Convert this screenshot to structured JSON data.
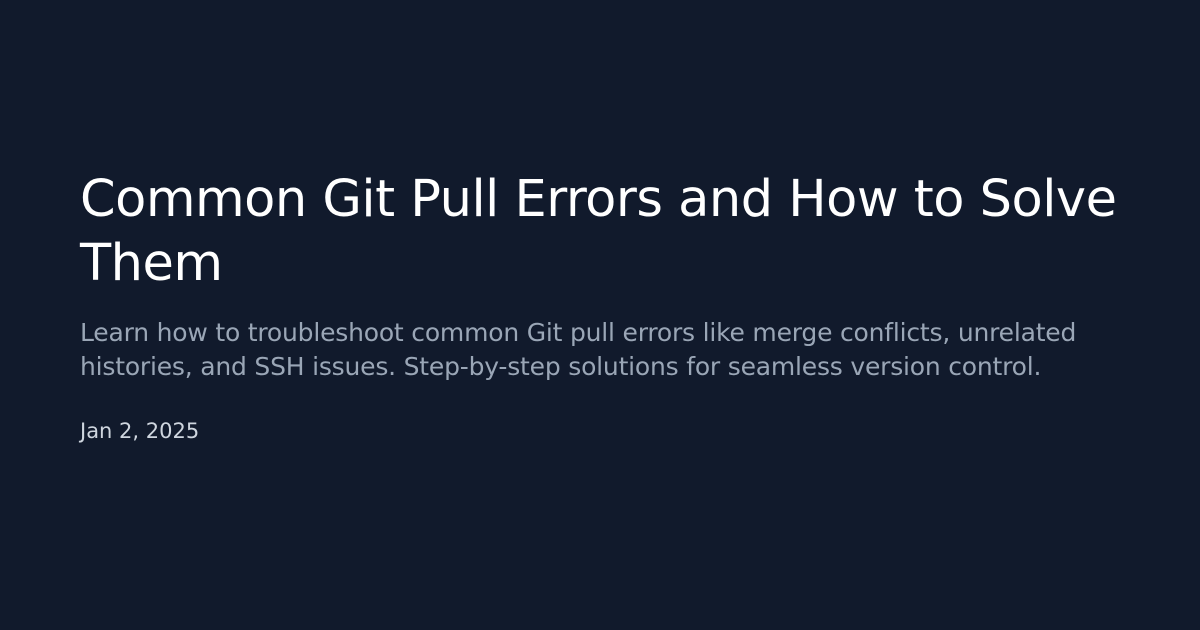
{
  "post": {
    "title": "Common Git Pull Errors and How to Solve Them",
    "description": "Learn how to troubleshoot common Git pull errors like merge conflicts, unrelated histories, and SSH issues. Step-by-step solutions for seamless version control.",
    "date": "Jan 2, 2025"
  },
  "colors": {
    "background": "#111a2c",
    "title": "#ffffff",
    "description": "#9aa6b6",
    "date": "#cfd6df"
  }
}
